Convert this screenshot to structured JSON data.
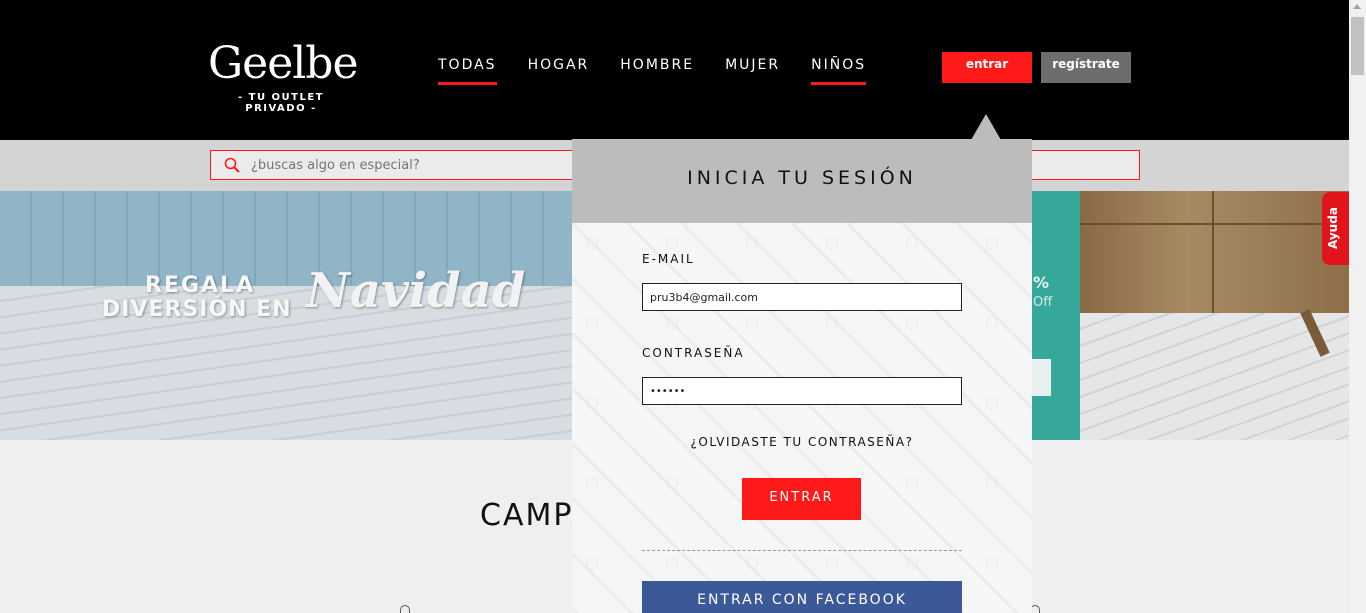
{
  "header": {
    "logo": {
      "wordmark": "Geelbe",
      "tagline": "- TU OUTLET PRIVADO -"
    },
    "nav": [
      {
        "label": "TODAS",
        "active": true
      },
      {
        "label": "HOGAR",
        "active": false
      },
      {
        "label": "HOMBRE",
        "active": false
      },
      {
        "label": "MUJER",
        "active": false
      },
      {
        "label": "NIÑOS",
        "active": true
      }
    ],
    "login_label": "entrar",
    "register_label": "regístrate"
  },
  "search": {
    "placeholder": "¿buscas algo en especial?",
    "icon": "search-icon"
  },
  "banner": {
    "line1": "REGALA",
    "line2": "DIVERSIÓN EN",
    "script": "Navidad",
    "promo_pct": "%",
    "promo_off": "Off"
  },
  "help_tab": {
    "label": "Ayuda"
  },
  "campaigns": {
    "title": "CAMPA"
  },
  "login_popup": {
    "title": "INICIA TU SESIÓN",
    "email_label": "E-MAIL",
    "email_value": "pru3b4@gmail.com",
    "password_label": "CONTRASEÑA",
    "password_value": "••••••",
    "forgot_label": "¿OLVIDASTE TU CONTRASEÑA?",
    "submit_label": "ENTRAR",
    "facebook_label": "ENTRAR CON FACEBOOK"
  },
  "colors": {
    "accent": "#ff1a1a",
    "header_bg": "#000000",
    "facebook": "#3b5998",
    "register_bg": "#6d6d6d"
  }
}
